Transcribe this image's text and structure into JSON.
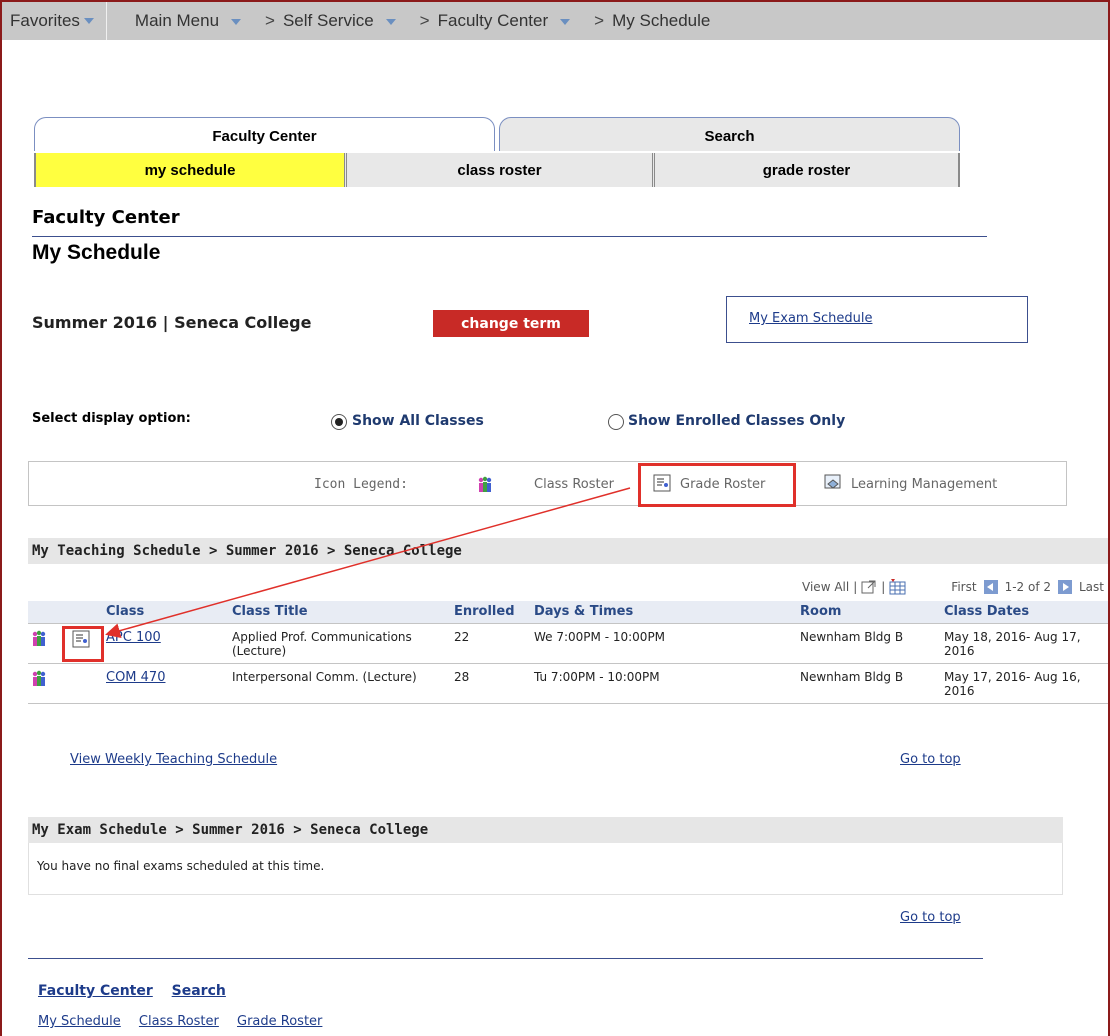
{
  "topbar": {
    "favorites": "Favorites",
    "main_menu": "Main Menu",
    "self_service": "Self Service",
    "faculty_center": "Faculty Center",
    "current": "My Schedule"
  },
  "tabs": {
    "primary": [
      "Faculty Center",
      "Search"
    ],
    "secondary": [
      "my schedule",
      "class roster",
      "grade roster"
    ]
  },
  "page": {
    "section_title": "Faculty Center",
    "title": "My Schedule",
    "term": "Summer 2016 | Seneca College",
    "change_term": "change term",
    "exam_link": "My Exam Schedule"
  },
  "display_options": {
    "label": "Select display option:",
    "option_all": "Show All Classes",
    "option_enrolled": "Show Enrolled Classes Only",
    "selected": "Show All Classes"
  },
  "legend": {
    "label": "Icon Legend:",
    "class_roster": "Class Roster",
    "grade_roster": "Grade Roster",
    "learning_management": "Learning Management"
  },
  "teaching": {
    "heading": "My Teaching Schedule > Summer 2016 > Seneca College",
    "view_all": "View All",
    "first": "First",
    "range": "1-2 of 2",
    "last": "Last",
    "columns": [
      "Class",
      "Class Title",
      "Enrolled",
      "Days & Times",
      "Room",
      "Class Dates"
    ],
    "rows": [
      {
        "class": "APC 100",
        "title": "Applied Prof. Communications (Lecture)",
        "enrolled": "22",
        "days_times": "We 7:00PM - 10:00PM",
        "room": "Newnham Bldg B",
        "dates": "May 18, 2016- Aug 17, 2016"
      },
      {
        "class": "COM 470",
        "title": "Interpersonal Comm. (Lecture)",
        "enrolled": "28",
        "days_times": "Tu 7:00PM - 10:00PM",
        "room": "Newnham Bldg B",
        "dates": "May 17, 2016- Aug 16, 2016"
      }
    ],
    "weekly_link": "View Weekly Teaching Schedule",
    "go_to_top": "Go to top"
  },
  "exam": {
    "heading": "My Exam Schedule > Summer 2016 > Seneca College",
    "message": "You have no final exams scheduled at this time.",
    "go_to_top": "Go to top"
  },
  "footer": {
    "nav1": [
      "Faculty Center",
      "Search"
    ],
    "nav2": [
      "My Schedule",
      "Class Roster",
      "Grade Roster"
    ]
  },
  "colors": {
    "accent_red": "#c82a26",
    "highlight": "#e0302a",
    "selected_tab": "#ffff40",
    "link": "#1d3b8a"
  }
}
